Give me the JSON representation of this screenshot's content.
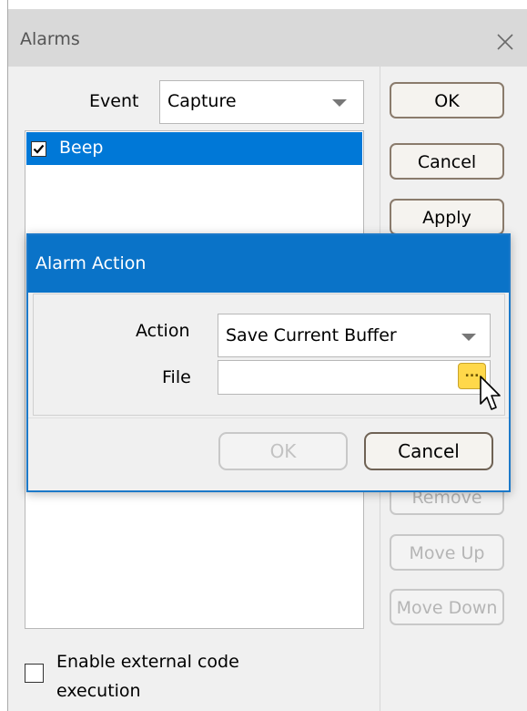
{
  "alarms_window": {
    "title": "Alarms",
    "event_label": "Event",
    "event_value": "Capture",
    "alarm_list": [
      {
        "label": "Beep",
        "checked": true,
        "selected": true
      }
    ],
    "external_code_label": "Enable external code execution",
    "external_code_checked": false,
    "buttons": {
      "ok": "OK",
      "cancel": "Cancel",
      "apply": "Apply",
      "remove": "Remove",
      "move_up": "Move Up",
      "move_down": "Move Down"
    }
  },
  "alarm_action_dialog": {
    "title": "Alarm Action",
    "action_label": "Action",
    "action_value": "Save Current Buffer",
    "file_label": "File",
    "file_value": "",
    "browse_label": "...",
    "ok_label": "OK",
    "cancel_label": "Cancel"
  },
  "colors": {
    "accent": "#0a73c8",
    "selection": "#0078d7",
    "browse_button": "#ffd84a"
  },
  "icons": [
    "close-icon",
    "checkmark-icon",
    "mouse-cursor-icon"
  ]
}
